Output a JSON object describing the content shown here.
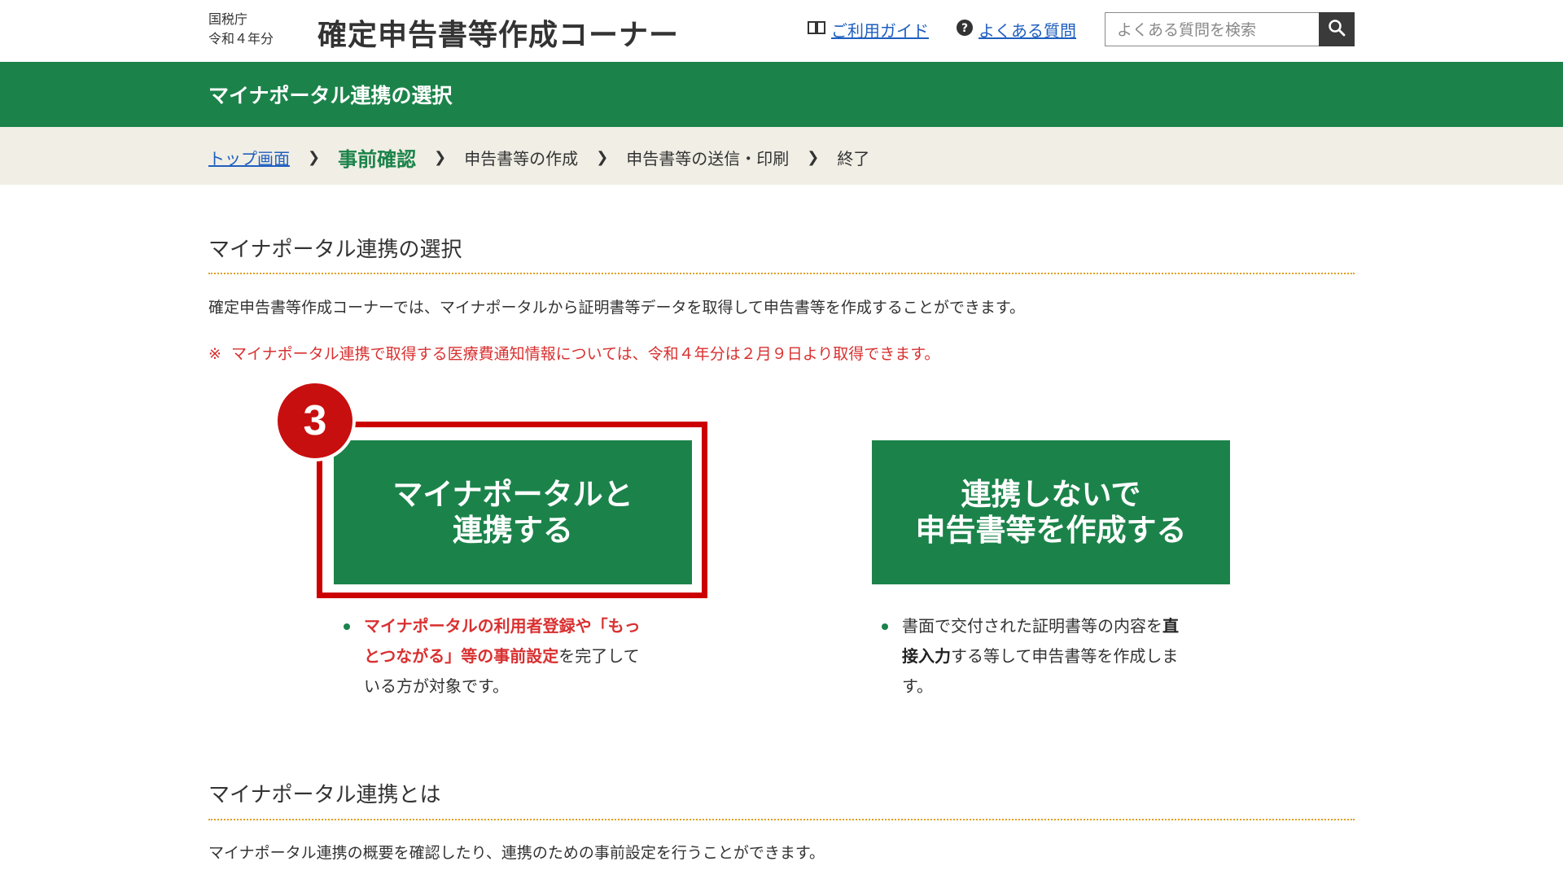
{
  "header": {
    "agency": "国税庁",
    "year": "令和４年分",
    "site_title": "確定申告書等作成コーナー",
    "guide_link": "ご利用ガイド",
    "faq_link": "よくある質問",
    "search_placeholder": "よくある質問を検索"
  },
  "band_title": "マイナポータル連携の選択",
  "breadcrumb": {
    "top": "トップ画面",
    "current": "事前確認",
    "step3": "申告書等の作成",
    "step4": "申告書等の送信・印刷",
    "step5": "終了"
  },
  "section1": {
    "heading": "マイナポータル連携の選択",
    "description": "確定申告書等作成コーナーでは、マイナポータルから証明書等データを取得して申告書等を作成することができます。",
    "note_mark": "※",
    "note": "マイナポータル連携で取得する医療費通知情報については、令和４年分は２月９日より取得できます。"
  },
  "step_badge": "3",
  "buttons": {
    "connect_line1": "マイナポータルと",
    "connect_line2": "連携する",
    "noconnect_line1": "連携しないで",
    "noconnect_line2": "申告書等を作成する"
  },
  "connect_desc": {
    "red_part": "マイナポータルの利用者登録や「もっとつながる」等の事前設定",
    "rest": "を完了している方が対象です。"
  },
  "noconnect_desc": {
    "part1": "書面で交付された証明書等の内容を",
    "bold": "直接入力",
    "part2": "する等して申告書等を作成します。"
  },
  "section2": {
    "heading": "マイナポータル連携とは",
    "description": "マイナポータル連携の概要を確認したり、連携のための事前設定を行うことができます。"
  },
  "colors": {
    "green": "#1b834a",
    "highlight_red": "#cc0000",
    "note_red": "#d93030",
    "link_blue": "#1f5fbf"
  }
}
